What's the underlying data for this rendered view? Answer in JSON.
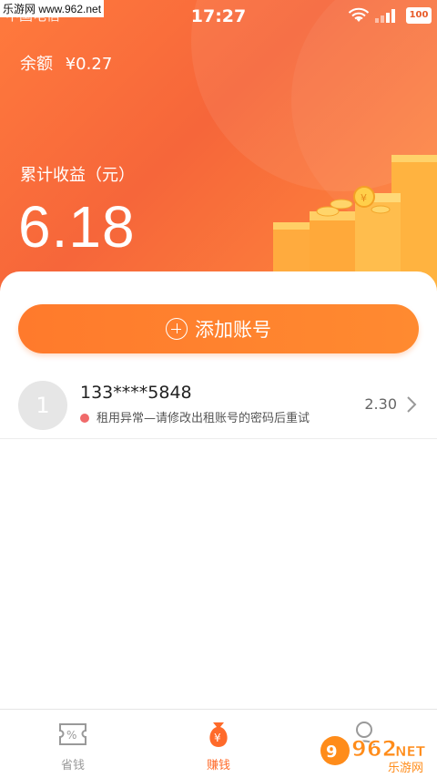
{
  "watermark": "乐游网 www.962.net",
  "status_bar": {
    "carrier": "中国电信",
    "time": "17:27",
    "battery": "100"
  },
  "balance": {
    "label": "余额",
    "value": "¥0.27"
  },
  "earnings": {
    "label": "累计收益（元）",
    "value": "6.18"
  },
  "add_account_label": "添加账号",
  "accounts": [
    {
      "avatar": "1",
      "number": "133****5848",
      "status": "租用异常—请修改出租账号的密码后重试",
      "amount": "2.30"
    }
  ],
  "tabs": [
    {
      "label": "省钱",
      "icon": "ticket-icon",
      "active": false
    },
    {
      "label": "赚钱",
      "icon": "money-bag-icon",
      "active": true
    },
    {
      "label": "",
      "icon": "user-icon",
      "active": false
    }
  ],
  "brand": {
    "big": "962",
    "net": "NET",
    "cn": "乐游网"
  },
  "colors": {
    "accent": "#ff6a2a",
    "hero_start": "#ff7a3d",
    "hero_end": "#ff8a3c",
    "error_dot": "#f06a6a"
  }
}
